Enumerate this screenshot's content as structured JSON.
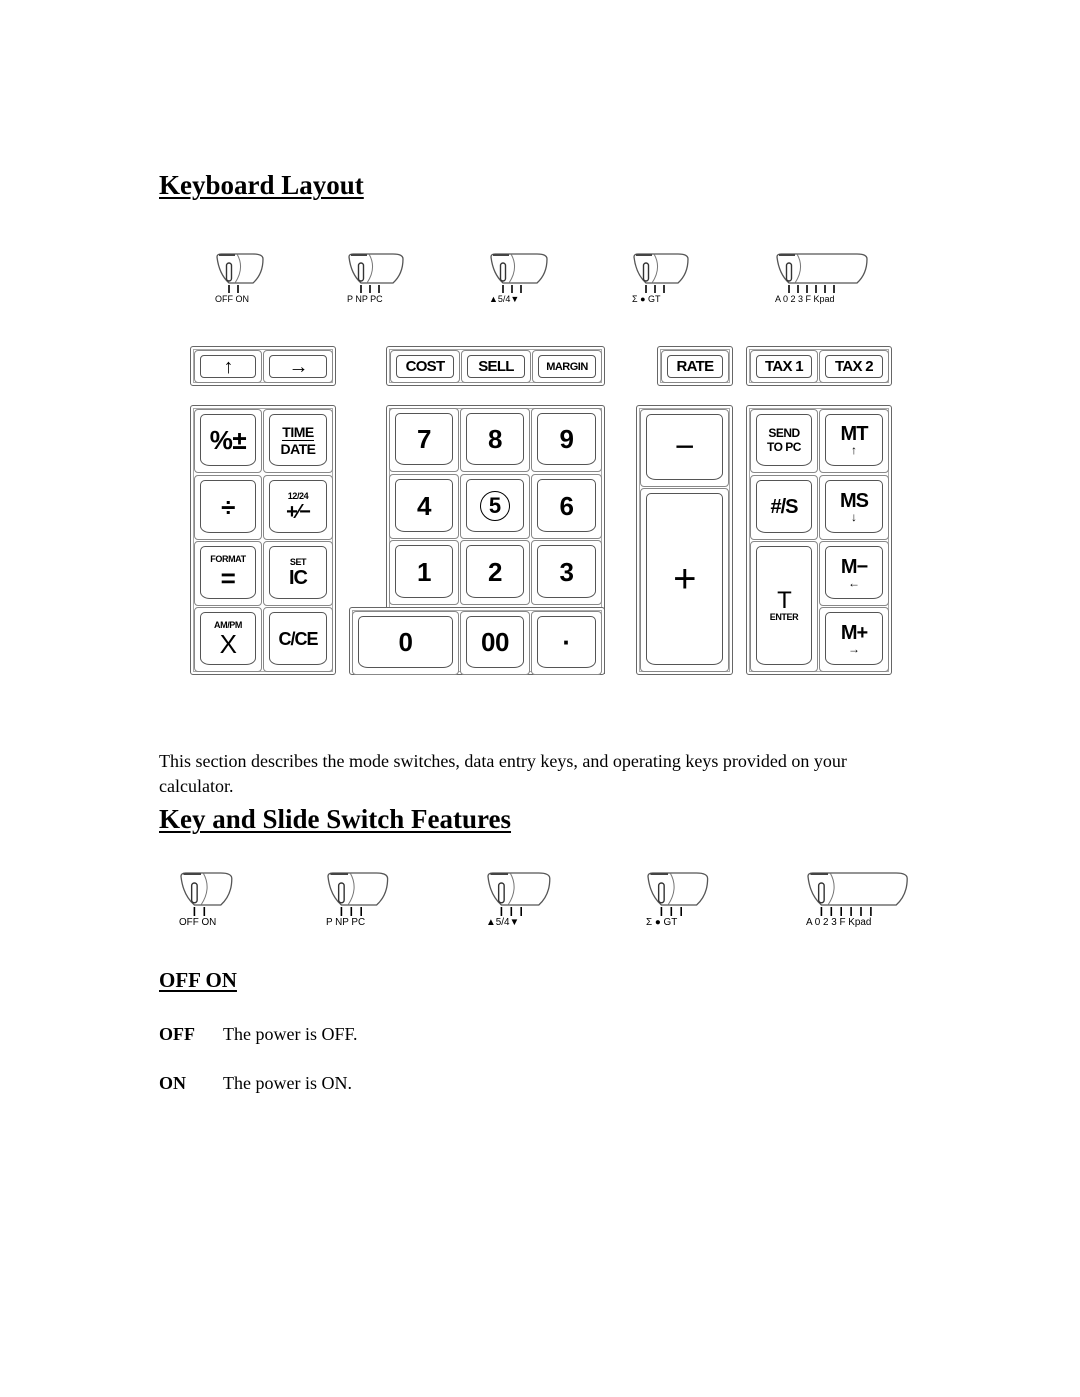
{
  "page": {
    "title": "Keyboard Layout",
    "intro": "This section describes the mode switches, data entry keys, and operating keys provided on your calculator.",
    "section_title": "Key and Slide Switch Features",
    "subsection_title": "OFF  ON",
    "definitions": [
      {
        "term": "OFF",
        "desc": "The power is OFF."
      },
      {
        "term": "ON",
        "desc": "The power is ON."
      }
    ]
  },
  "switches": [
    {
      "name": "power",
      "labels": "OFF ON",
      "positions": [
        "OFF",
        "ON"
      ]
    },
    {
      "name": "print-mode",
      "labels": "P NP PC",
      "positions": [
        "P",
        "NP",
        "PC"
      ]
    },
    {
      "name": "rounding",
      "labels": "▲5/4▼",
      "positions": [
        "▲",
        "5/4",
        "▼"
      ]
    },
    {
      "name": "accumulation",
      "labels": "Σ ● GT",
      "positions": [
        "Σ",
        "●",
        "GT"
      ]
    },
    {
      "name": "decimal",
      "labels": "A 0 2 3 F Kpad",
      "positions": [
        "A",
        "0",
        "2",
        "3",
        "F",
        "Kpad"
      ]
    }
  ],
  "keys": {
    "paper_feed": "↑",
    "advance": "→",
    "cost": "COST",
    "sell": "SELL",
    "margin": "MARGIN",
    "rate": "RATE",
    "tax1": "TAX 1",
    "tax2": "TAX 2",
    "percent": "%±",
    "time_top": "TIME",
    "time_bottom": "DATE",
    "divide": "÷",
    "rev_top": "12/24",
    "rev": "+⁄−",
    "equals_top": "FORMAT",
    "equals": "=",
    "ic_top": "SET",
    "ic": "IC",
    "multiply_top": "AM/PM",
    "multiply": "X",
    "clear": "C/CE",
    "d7": "7",
    "d8": "8",
    "d9": "9",
    "d4": "4",
    "d5": "5",
    "d6": "6",
    "d1": "1",
    "d2": "2",
    "d3": "3",
    "d0": "0",
    "d00": "00",
    "dot": "·",
    "minus": "−",
    "plus": "+",
    "send_1": "SEND",
    "send_2": "TO PC",
    "mt": "MT",
    "mt_arrow": "↑",
    "num_s": "#/S",
    "ms": "MS",
    "ms_arrow": "↓",
    "total": "T",
    "total_sub": "ENTER",
    "mminus": "M−",
    "mminus_arrow": "←",
    "mplus": "M+",
    "mplus_arrow": "→"
  }
}
